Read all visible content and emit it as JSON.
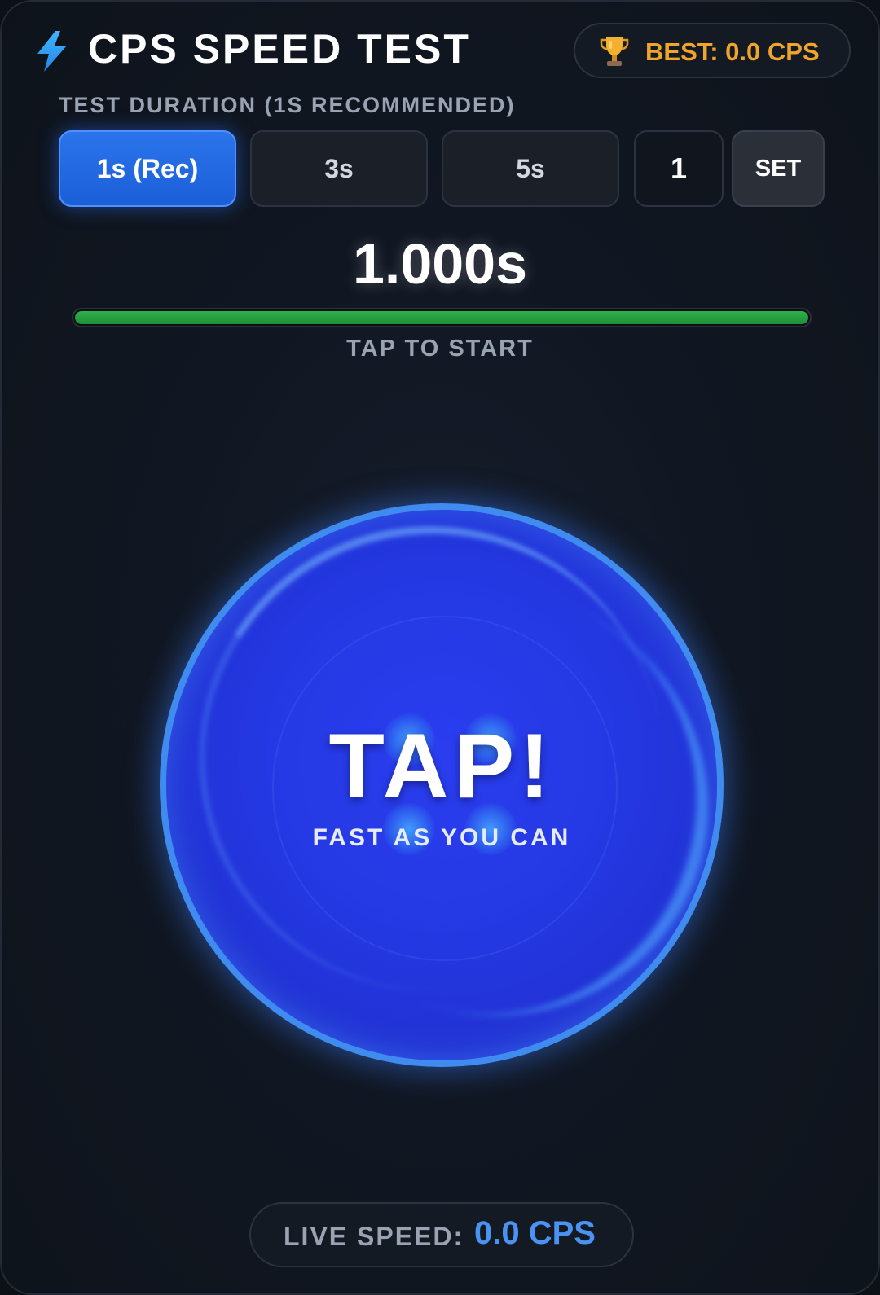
{
  "header": {
    "title": "CPS SPEED TEST",
    "best_label": "BEST: 0.0 CPS"
  },
  "duration": {
    "label": "TEST DURATION (1S RECOMMENDED)",
    "options": [
      {
        "label": "1s (Rec)",
        "active": true
      },
      {
        "label": "3s",
        "active": false
      },
      {
        "label": "5s",
        "active": false
      }
    ],
    "custom_value": "1",
    "set_label": "SET"
  },
  "timer": {
    "value": "1.000s",
    "progress": 1.0,
    "status": "TAP TO START"
  },
  "tap_button": {
    "label": "TAP!",
    "sub_label": "FAST AS YOU CAN"
  },
  "live": {
    "label": "LIVE SPEED:",
    "value": "0.0 CPS"
  },
  "colors": {
    "accent_blue": "#2b74ec",
    "best_gold": "#f0a52a",
    "progress_green": "#2fb14a",
    "live_value_blue": "#4b93f2"
  },
  "icons": {
    "header": "lightning-bolt-icon",
    "best": "trophy-icon"
  }
}
